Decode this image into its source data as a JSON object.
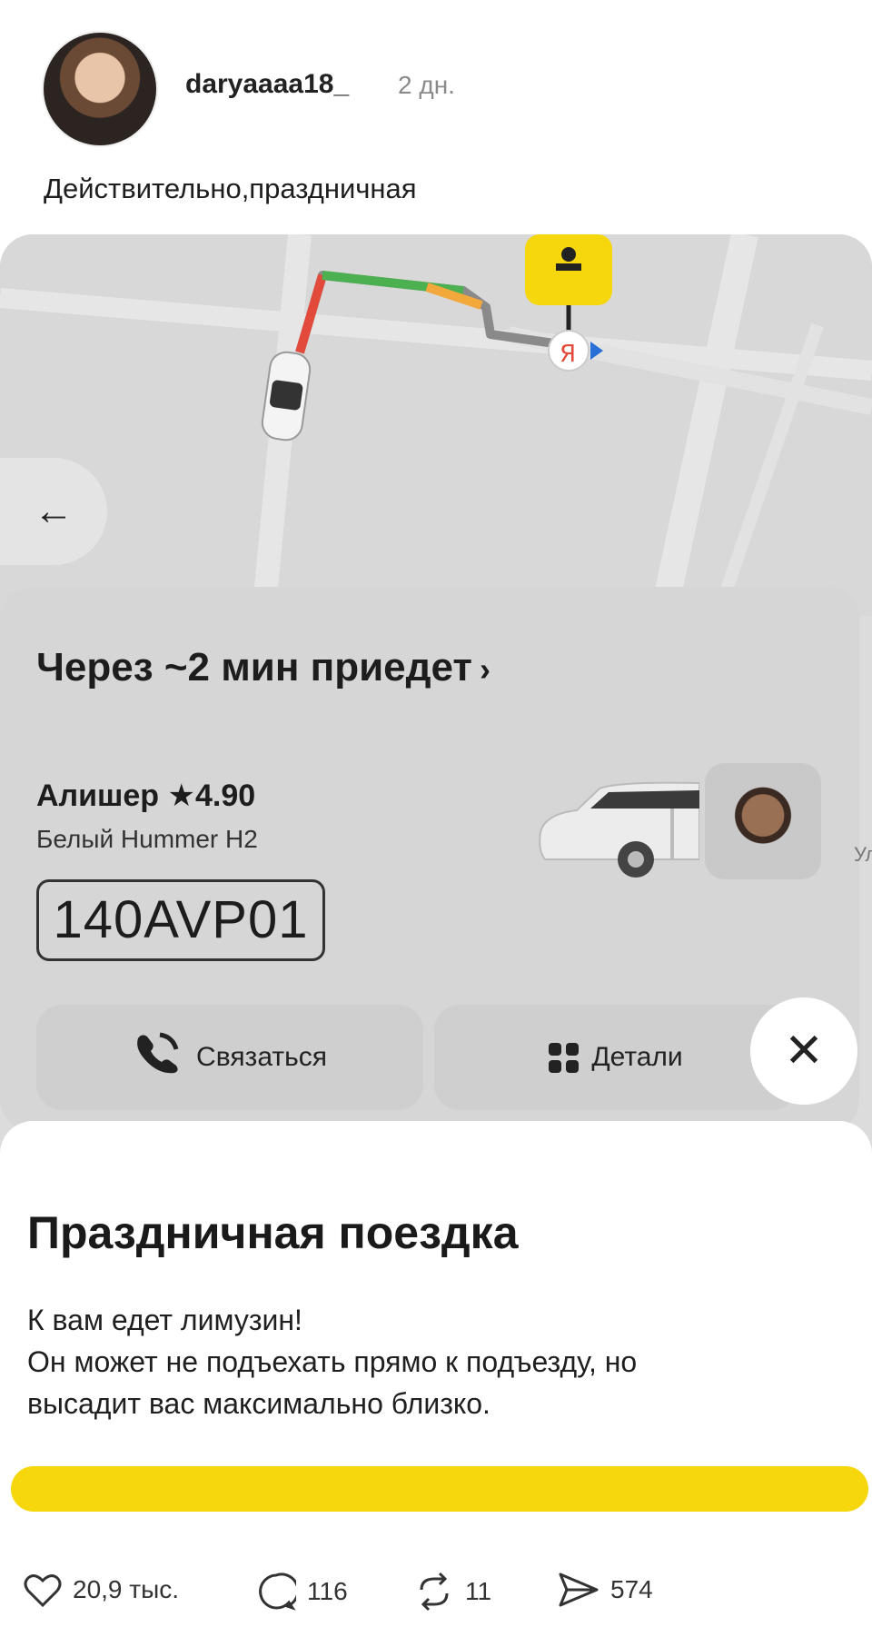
{
  "post": {
    "username": "daryaaaa18_",
    "time": "2 дн.",
    "caption": "Действительно,праздничная"
  },
  "ride": {
    "eta": "Через ~2 мин приедет",
    "eta_chevron": "›",
    "back_glyph": "←",
    "driver_name": "Алишер ★4.90",
    "car_model": "Белый Hummer H2",
    "plate": "140AVP01",
    "contact_label": "Связаться",
    "details_label": "Детали",
    "close_glyph": "✕",
    "side_text": "Ул"
  },
  "sheet": {
    "title": "Праздничная поездка",
    "line1": "К вам едет лимузин!",
    "line2": "Он может не подъехать прямо к подъезду, но",
    "line3": "высадит вас максимально близко."
  },
  "actions": {
    "likes": "20,9 тыс.",
    "comments": "116",
    "reposts": "11",
    "shares": "574"
  },
  "colors": {
    "accent_yellow": "#f6d60c",
    "route_green": "#4caf50",
    "route_red": "#e24a3b"
  }
}
